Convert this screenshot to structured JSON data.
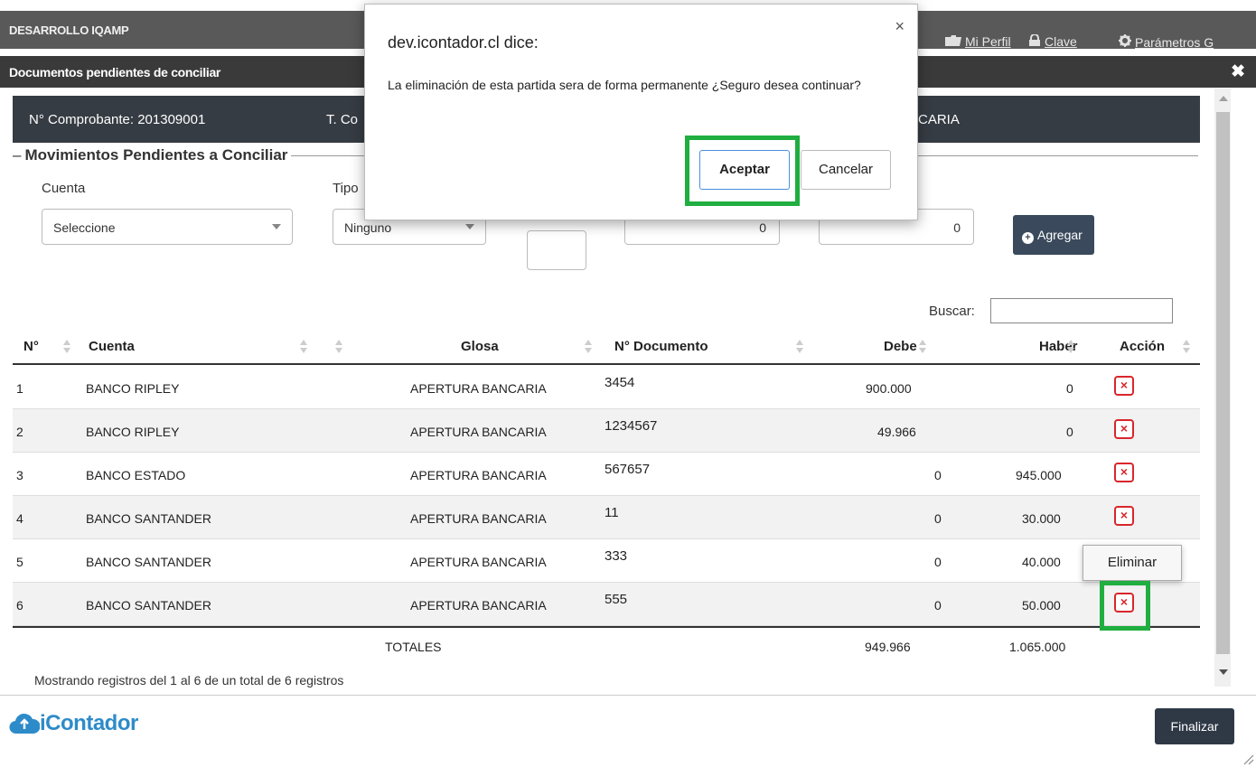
{
  "topbar": {
    "brand": "DESARROLLO IQAMP",
    "links": [
      {
        "icon": "folder-icon",
        "label": "Mi Perfil"
      },
      {
        "icon": "lock-icon",
        "label": "Clave"
      },
      {
        "icon": "gear-icon",
        "label": "Parámetros G"
      }
    ]
  },
  "modal": {
    "title": "Documentos pendientes de conciliar",
    "close": "✖"
  },
  "info": {
    "comprobante": "N° Comprobante:  201309001",
    "tipo_fragment": "T. Co",
    "glosa_fragment": "CARIA"
  },
  "form": {
    "legend": "Movimientos Pendientes a Conciliar",
    "cuenta_label": "Cuenta",
    "cuenta_value": "Seleccione",
    "tipo_label": "Tipo",
    "tipo_value": "Ninguno",
    "doc_value": "",
    "debe_value": "0",
    "haber_value": "0",
    "agregar": "Agregar"
  },
  "search": {
    "label": "Buscar:",
    "value": ""
  },
  "table": {
    "headers": {
      "n": "N°",
      "cuenta": "Cuenta",
      "glosa": "Glosa",
      "documento": "N° Documento",
      "debe": "Debe",
      "haber": "Haber",
      "accion": "Acción"
    },
    "rows": [
      {
        "n": "1",
        "cuenta": "BANCO RIPLEY",
        "glosa": "APERTURA BANCARIA",
        "documento": "3454",
        "debe": "900.000",
        "haber": "0"
      },
      {
        "n": "2",
        "cuenta": "BANCO RIPLEY",
        "glosa": "APERTURA BANCARIA",
        "documento": "1234567",
        "debe": "49.966",
        "haber": "0"
      },
      {
        "n": "3",
        "cuenta": "BANCO ESTADO",
        "glosa": "APERTURA BANCARIA",
        "documento": "567657",
        "debe": "0",
        "haber": "945.000"
      },
      {
        "n": "4",
        "cuenta": "BANCO SANTANDER",
        "glosa": "APERTURA BANCARIA",
        "documento": "11",
        "debe": "0",
        "haber": "30.000"
      },
      {
        "n": "5",
        "cuenta": "BANCO SANTANDER",
        "glosa": "APERTURA BANCARIA",
        "documento": "333",
        "debe": "0",
        "haber": "40.000"
      },
      {
        "n": "6",
        "cuenta": "BANCO SANTANDER",
        "glosa": "APERTURA BANCARIA",
        "documento": "555",
        "debe": "0",
        "haber": "50.000"
      }
    ],
    "delete_glyph": "×",
    "totals": {
      "label": "TOTALES",
      "debe": "949.966",
      "haber": "1.065.000"
    },
    "info": "Mostrando registros del 1 al 6 de un total de 6 registros"
  },
  "tooltip": "Eliminar",
  "footer": {
    "logo": "iContador",
    "finalizar": "Finalizar"
  },
  "dialog": {
    "title": "dev.icontador.cl dice:",
    "message": "La eliminación de esta partida sera de forma permanente ¿Seguro desea continuar?",
    "close": "×",
    "ok": "Aceptar",
    "cancel": "Cancelar"
  },
  "colors": {
    "highlight": "#1fae3f",
    "delete": "#d9262c",
    "logo": "#2e8bc9"
  }
}
